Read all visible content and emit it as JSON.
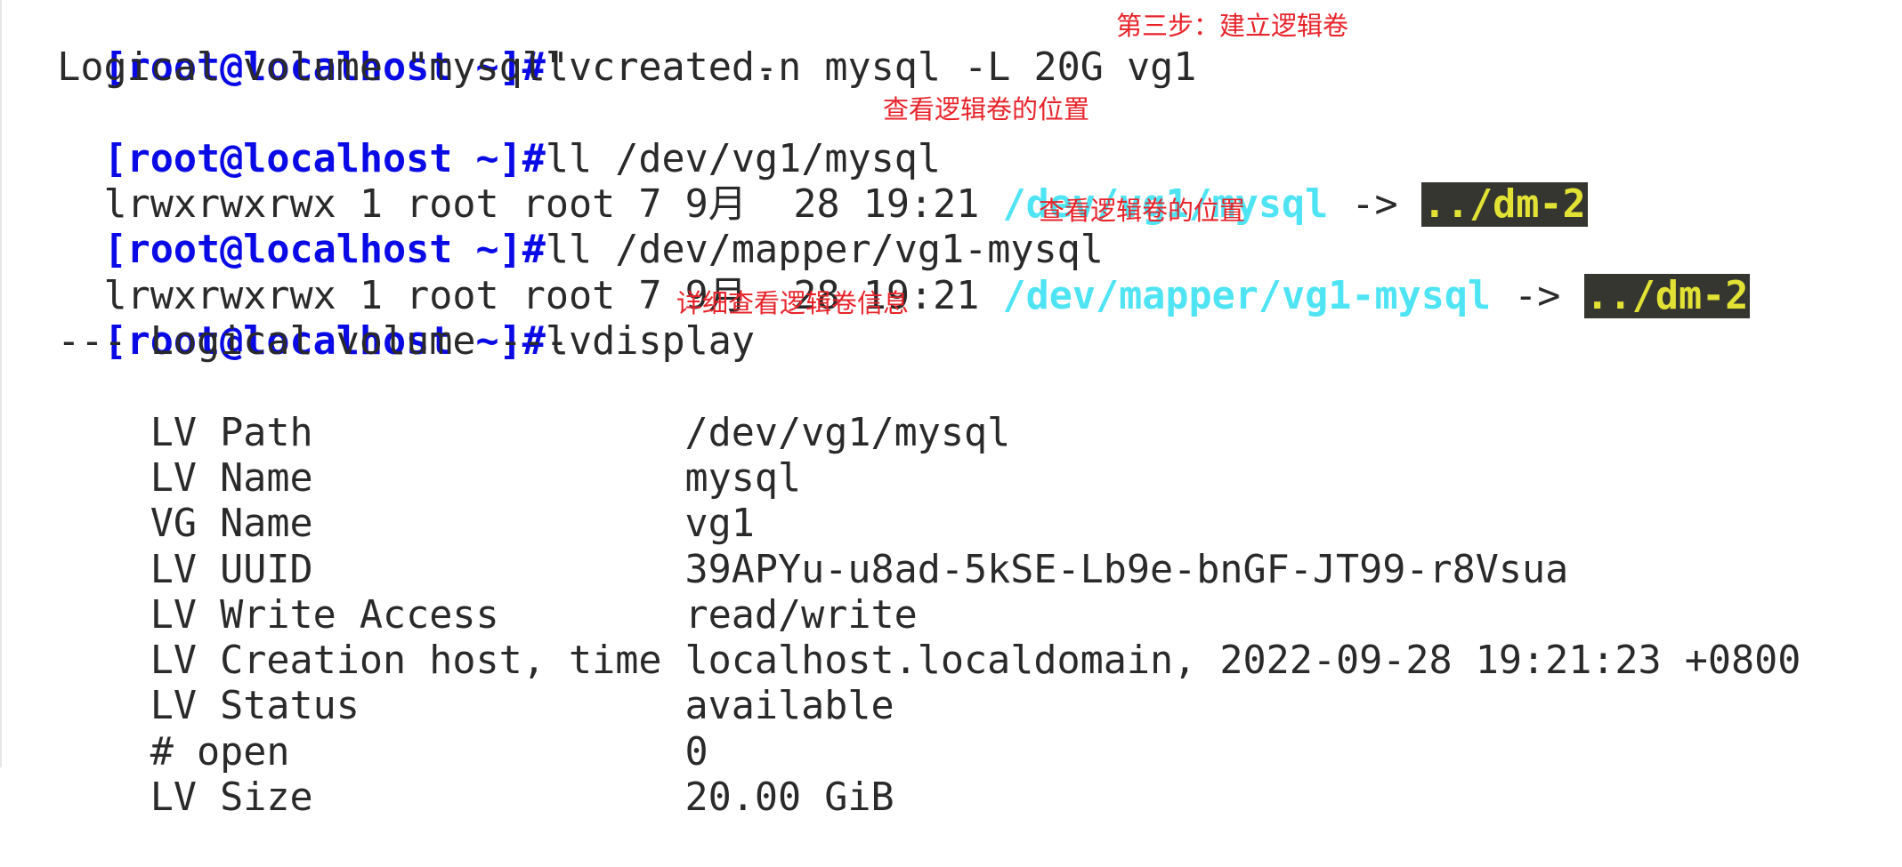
{
  "terminal": {
    "prompt": "[root@localhost ~]#",
    "colors": {
      "prompt": "#0a0ae6",
      "text": "#2a2a2a",
      "symlink": "#4ee4f4",
      "link_target_fg": "#e2e234",
      "link_target_bg": "#353630",
      "annotation": "#e8232a"
    },
    "lines": {
      "cmd1": "lvcreate -n mysql -L 20G vg1",
      "out1": "  Logical volume \"mysql\" created.",
      "cmd2": "ll /dev/vg1/mysql",
      "out2_prefix": "lrwxrwxrwx 1 root root 7 9月  28 19:21 ",
      "out2_link": "/dev/vg1/mysql",
      "out2_arrow": " -> ",
      "out2_target": "../dm-2",
      "cmd3": "ll /dev/mapper/vg1-mysql",
      "out3_prefix": "lrwxrwxrwx 1 root root 7 9月  28 19:21 ",
      "out3_link": "/dev/mapper/vg1-mysql",
      "out3_arrow": " -> ",
      "out3_target": "../dm-2",
      "cmd4": "lvdisplay",
      "lv_header": "  --- Logical volume ---"
    },
    "lvdisplay": [
      {
        "key": "  LV Path",
        "value": "/dev/vg1/mysql"
      },
      {
        "key": "  LV Name",
        "value": "mysql"
      },
      {
        "key": "  VG Name",
        "value": "vg1"
      },
      {
        "key": "  LV UUID",
        "value": "39APYu-u8ad-5kSE-Lb9e-bnGF-JT99-r8Vsua"
      },
      {
        "key": "  LV Write Access",
        "value": "read/write"
      },
      {
        "key": "  LV Creation host, time",
        "value": "localhost.localdomain, 2022-09-28 19:21:23 +0800"
      },
      {
        "key": "  LV Status",
        "value": "available"
      },
      {
        "key": "  # open",
        "value": "0"
      },
      {
        "key": "  LV Size",
        "value": "20.00 GiB"
      }
    ]
  },
  "annotations": {
    "step3": "第三步：建立逻辑卷",
    "view_location_1": "查看逻辑卷的位置",
    "view_location_2": "查看逻辑卷的位置",
    "view_detail": "详细查看逻辑卷信息"
  }
}
